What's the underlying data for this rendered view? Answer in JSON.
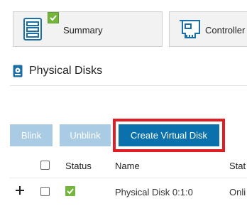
{
  "tabs": {
    "summary": {
      "label": "Summary",
      "icon": "server-list-icon",
      "badge_icon": "check-icon"
    },
    "controllers": {
      "label": "Controller",
      "icon": "controller-card-icon"
    }
  },
  "section": {
    "title": "Physical Disks",
    "icon": "physical-disk-icon"
  },
  "toolbar": {
    "blink_label": "Blink",
    "unblink_label": "Unblink",
    "create_virtual_disk_label": "Create Virtual Disk"
  },
  "table": {
    "headers": {
      "status": "Status",
      "name": "Name",
      "state": "Stat"
    },
    "rows": [
      {
        "name": "Physical Disk 0:1:0",
        "state": "Onli",
        "status_icon": "check-icon"
      }
    ]
  },
  "colors": {
    "primary_button": "#0b71ad",
    "disabled_button": "#a9cbe3",
    "highlight_border": "#e01c24",
    "status_ok": "#74b53b"
  }
}
